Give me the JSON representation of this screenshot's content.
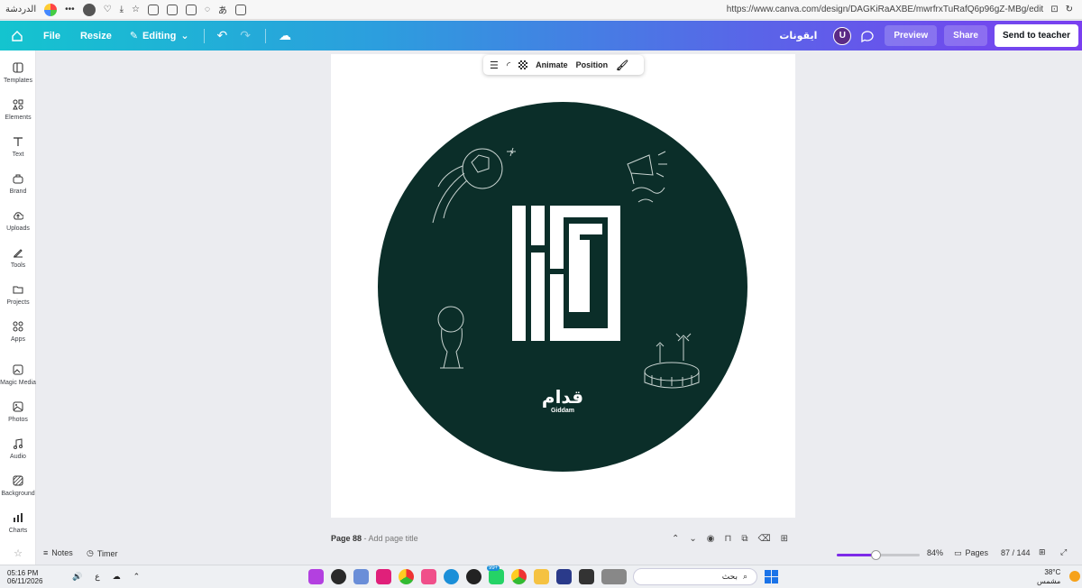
{
  "browser": {
    "profile_label": "الدردشة",
    "url": "https://www.canva.com/design/DAGKiRaAXBE/mwrfrxTuRafQ6p96gZ-MBg/edit"
  },
  "topbar": {
    "file": "File",
    "resize": "Resize",
    "editing": "Editing",
    "design_title": "ايقونات",
    "avatar_letter": "U",
    "preview": "Preview",
    "share": "Share",
    "send": "Send to teacher"
  },
  "sidebar": {
    "items": [
      {
        "label": "Templates",
        "icon": "templates-icon"
      },
      {
        "label": "Elements",
        "icon": "elements-icon"
      },
      {
        "label": "Text",
        "icon": "text-icon"
      },
      {
        "label": "Brand",
        "icon": "brand-icon"
      },
      {
        "label": "Uploads",
        "icon": "uploads-icon"
      },
      {
        "label": "Tools",
        "icon": "tools-icon"
      },
      {
        "label": "Projects",
        "icon": "projects-icon"
      },
      {
        "label": "Apps",
        "icon": "apps-icon"
      },
      {
        "label": "Magic Media",
        "icon": "magic-media-icon"
      },
      {
        "label": "Photos",
        "icon": "photos-icon"
      },
      {
        "label": "Audio",
        "icon": "audio-icon"
      },
      {
        "label": "Background",
        "icon": "background-icon"
      },
      {
        "label": "Charts",
        "icon": "charts-icon"
      }
    ]
  },
  "toolbar": {
    "animate": "Animate",
    "position": "Position"
  },
  "design": {
    "circle_color": "#0b2e29",
    "logo_arabic": "قدام",
    "logo_latin": "Giddam"
  },
  "page": {
    "label": "Page 88",
    "title_placeholder": "- Add page title"
  },
  "bottom": {
    "notes": "Notes",
    "timer": "Timer",
    "zoom": "84%",
    "zoom_fraction": 0.84,
    "pages": "Pages",
    "page_count": "87 / 144"
  },
  "taskbar": {
    "time": "05:16 PM",
    "date": "06/11/2026",
    "lang": "ع",
    "search_placeholder": "بحث",
    "badge": "99+",
    "temperature": "38°C",
    "weather": "مشمس"
  }
}
